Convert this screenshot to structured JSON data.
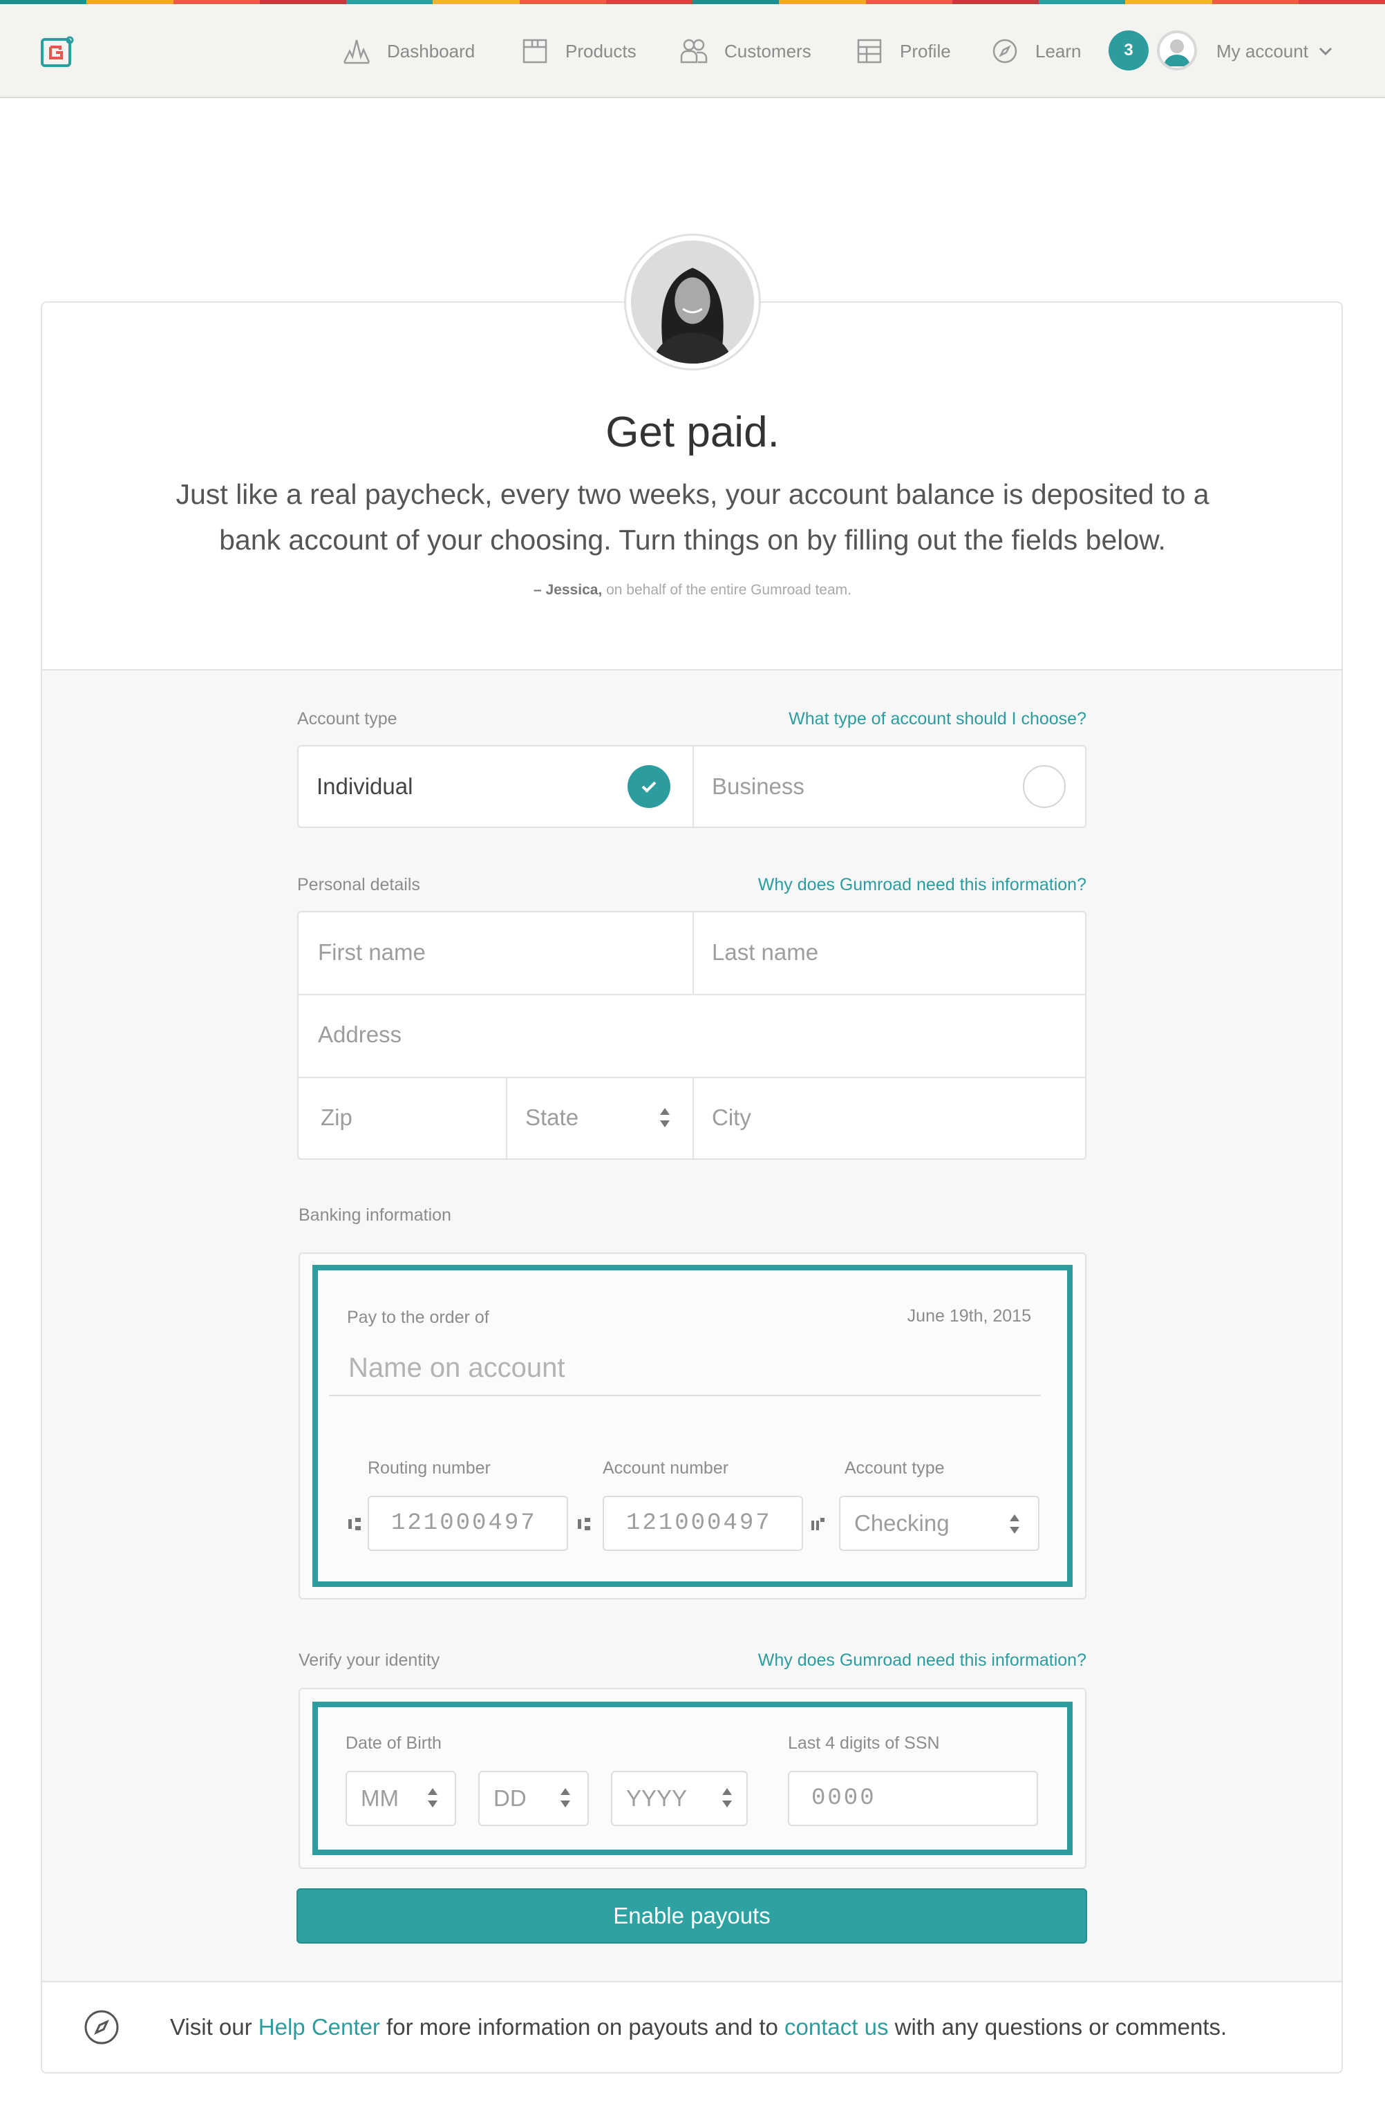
{
  "nav": {
    "items": [
      {
        "label": "Dashboard",
        "icon": "dashboard-icon"
      },
      {
        "label": "Products",
        "icon": "products-icon"
      },
      {
        "label": "Customers",
        "icon": "customers-icon"
      },
      {
        "label": "Profile",
        "icon": "profile-icon"
      },
      {
        "label": "Learn",
        "icon": "compass-icon"
      }
    ],
    "notification_count": "3",
    "account_label": "My account"
  },
  "hero": {
    "title": "Get paid.",
    "line1": "Just like a real paycheck, every two weeks, your account balance is deposited to a",
    "line2": "bank account of your choosing. Turn things on by filling out the fields below.",
    "signature_name": "– Jessica,",
    "signature_rest": "on behalf of the entire Gumroad team."
  },
  "account_type": {
    "label": "Account type",
    "help": "What type of account should I choose?",
    "options": [
      {
        "label": "Individual",
        "selected": true
      },
      {
        "label": "Business",
        "selected": false
      }
    ]
  },
  "personal": {
    "label": "Personal details",
    "help": "Why does Gumroad need this information?",
    "first_name_placeholder": "First name",
    "last_name_placeholder": "Last name",
    "address_placeholder": "Address",
    "zip_placeholder": "Zip",
    "state_placeholder": "State",
    "city_placeholder": "City"
  },
  "banking": {
    "label": "Banking information",
    "pay_to_label": "Pay to the order of",
    "date": "June 19th, 2015",
    "name_placeholder": "Name on account",
    "routing_label": "Routing number",
    "routing_placeholder": "121000497",
    "account_number_label": "Account number",
    "account_number_placeholder": "121000497",
    "account_type_label": "Account type",
    "account_type_value": "Checking"
  },
  "identity": {
    "label": "Verify your identity",
    "help": "Why does Gumroad need this information?",
    "dob_label": "Date of Birth",
    "mm": "MM",
    "dd": "DD",
    "yyyy": "YYYY",
    "ssn_label": "Last 4 digits of SSN",
    "ssn_placeholder": "0000"
  },
  "submit_label": "Enable payouts",
  "footer": {
    "pre": "Visit our ",
    "help_center": "Help Center",
    "mid": " for more information on payouts and to ",
    "contact": "contact us",
    "post": " with any questions or comments."
  },
  "colors": {
    "accent": "#2c9c9e",
    "nav_background": "#f4f3f0",
    "rainbow": [
      "#2c9c9e",
      "#f4a623",
      "#e8554e",
      "#c7373c",
      "#3fa9a6",
      "#f0b12c",
      "#e5593f",
      "#d94840"
    ]
  }
}
